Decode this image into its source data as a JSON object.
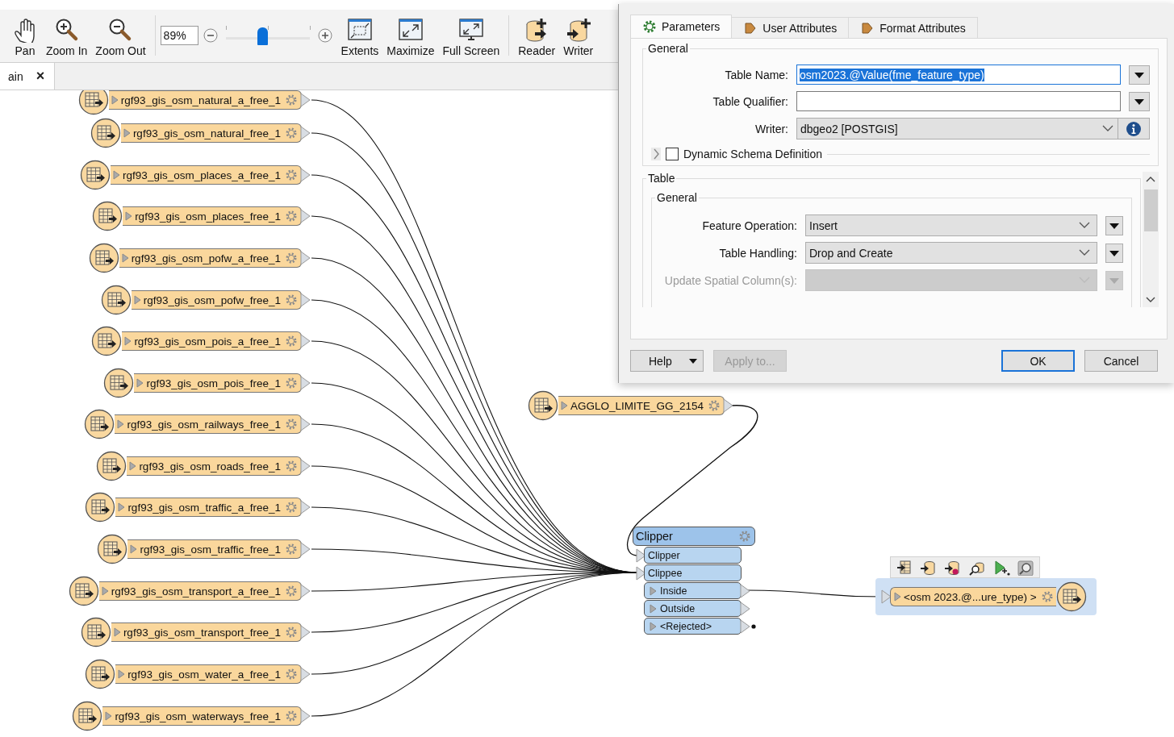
{
  "toolbar": {
    "tools": [
      {
        "label": "Pan"
      },
      {
        "label": "Zoom In"
      },
      {
        "label": "Zoom Out"
      }
    ],
    "zoom": {
      "value": "89%",
      "level": 0.44
    },
    "view_tools": [
      {
        "label": "Extents"
      },
      {
        "label": "Maximize"
      },
      {
        "label": "Full Screen"
      }
    ],
    "add_tools": [
      {
        "label": "Reader"
      },
      {
        "label": "Writer"
      }
    ]
  },
  "document_tab": {
    "label": "ain",
    "close": "×"
  },
  "canvas": {
    "readers": [
      {
        "name": "rgf93_gis_osm_natural_a_free_1"
      },
      {
        "name": "rgf93_gis_osm_natural_free_1"
      },
      {
        "name": "rgf93_gis_osm_places_a_free_1"
      },
      {
        "name": "rgf93_gis_osm_places_free_1"
      },
      {
        "name": "rgf93_gis_osm_pofw_a_free_1"
      },
      {
        "name": "rgf93_gis_osm_pofw_free_1"
      },
      {
        "name": "rgf93_gis_osm_pois_a_free_1"
      },
      {
        "name": "rgf93_gis_osm_pois_free_1"
      },
      {
        "name": "rgf93_gis_osm_railways_free_1"
      },
      {
        "name": "rgf93_gis_osm_roads_free_1"
      },
      {
        "name": "rgf93_gis_osm_traffic_a_free_1"
      },
      {
        "name": "rgf93_gis_osm_traffic_free_1"
      },
      {
        "name": "rgf93_gis_osm_transport_a_free_1"
      },
      {
        "name": "rgf93_gis_osm_transport_free_1"
      },
      {
        "name": "rgf93_gis_osm_water_a_free_1"
      },
      {
        "name": "rgf93_gis_osm_waterways_free_1"
      }
    ],
    "clip_boundary": {
      "name": "AGGLO_LIMITE_GG_2154"
    },
    "transformer": {
      "title": "Clipper",
      "ports": [
        {
          "label": "Clipper",
          "kind": "input"
        },
        {
          "label": "Clippee",
          "kind": "input"
        },
        {
          "label": "Inside",
          "kind": "output"
        },
        {
          "label": "Outside",
          "kind": "output"
        },
        {
          "label": "<Rejected>",
          "kind": "rejected"
        }
      ]
    },
    "writer": {
      "name": "<osm 2023.@...ure_type) >",
      "selected": true
    }
  },
  "dialog": {
    "tabs": [
      {
        "label": "Parameters",
        "selected": true
      },
      {
        "label": "User Attributes",
        "selected": false
      },
      {
        "label": "Format Attributes",
        "selected": false
      }
    ],
    "general": {
      "title": "General",
      "fields": [
        {
          "label": "Table Name:",
          "kind": "text",
          "value": "osm2023.@Value(fme_feature_type)",
          "text_selected": true
        },
        {
          "label": "Table Qualifier:",
          "kind": "text"
        },
        {
          "label": "Writer:",
          "kind": "connection",
          "value": "dbgeo2 [POSTGIS]"
        }
      ],
      "option": {
        "label": "Dynamic Schema Definition",
        "checked": false,
        "expanded": false
      }
    },
    "table": {
      "title": "Table",
      "group": {
        "title": "General",
        "fields": [
          {
            "label": "Feature Operation:",
            "kind": "select",
            "value": "Insert",
            "disabled": false
          },
          {
            "label": "Table Handling:",
            "kind": "select",
            "value": "Drop and Create",
            "disabled": false
          },
          {
            "label": "Update Spatial Column(s):",
            "kind": "select",
            "disabled": true
          }
        ]
      }
    },
    "buttons": [
      {
        "label": "Help",
        "kind": "menu",
        "disabled": false,
        "default": false
      },
      {
        "label": "Apply to...",
        "kind": "plain",
        "disabled": true,
        "default": false
      },
      {
        "label": "OK",
        "kind": "plain",
        "disabled": false,
        "default": true
      },
      {
        "label": "Cancel",
        "kind": "plain",
        "disabled": false,
        "default": false
      }
    ]
  }
}
